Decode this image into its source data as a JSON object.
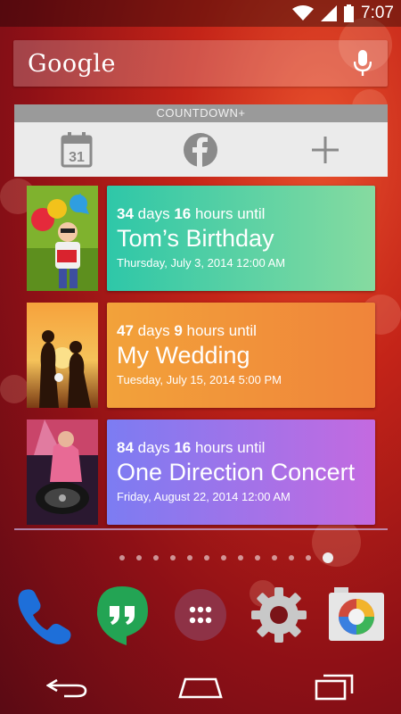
{
  "status_bar": {
    "time": "7:07"
  },
  "search": {
    "brand": "Google"
  },
  "widget": {
    "header": "COUNTDOWN+",
    "calendar_day": "31",
    "events": [
      {
        "num1": "34",
        "unit1": "days",
        "num2": "16",
        "unit2": "hours until",
        "title": "Tom’s Birthday",
        "date": "Thursday, July 3, 2014 12:00 AM",
        "color_from": "#2ec7a8",
        "color_to": "#86dba0"
      },
      {
        "num1": "47",
        "unit1": "days",
        "num2": "9",
        "unit2": "hours until",
        "title": "My Wedding",
        "date": "Tuesday, July 15, 2014 5:00 PM",
        "color_from": "#f2a23a",
        "color_to": "#f0843a"
      },
      {
        "num1": "84",
        "unit1": "days",
        "num2": "16",
        "unit2": "hours until",
        "title": "One Direction Concert",
        "date": "Friday, August 22, 2014 12:00 AM",
        "color_from": "#7c7cf2",
        "color_to": "#c46ae0"
      }
    ]
  },
  "dock": {
    "apps": [
      "phone-icon",
      "hangouts-icon",
      "app-drawer-icon",
      "settings-icon",
      "camera-icon"
    ]
  },
  "nav": {
    "buttons": [
      "back-icon",
      "home-icon",
      "recents-icon"
    ]
  }
}
